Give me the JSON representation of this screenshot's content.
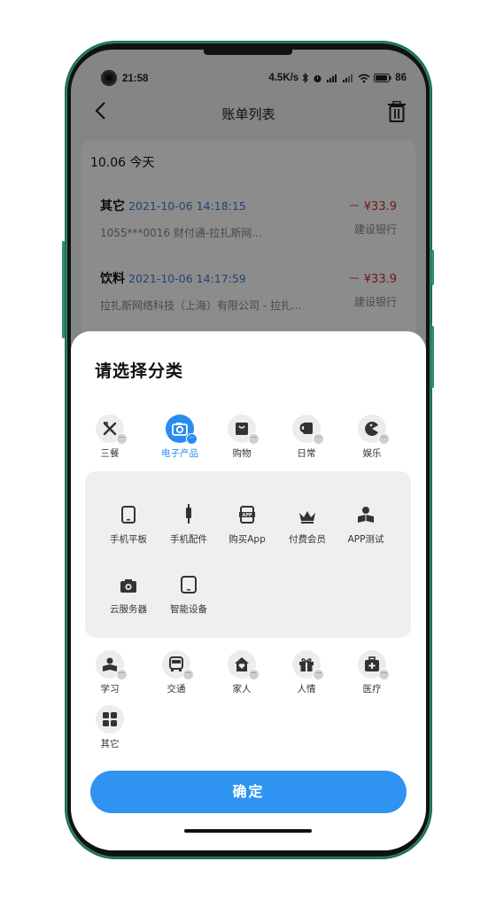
{
  "status": {
    "time": "21:58",
    "speed": "4.5K/s",
    "battery": "86"
  },
  "nav": {
    "title": "账单列表",
    "back_icon": "chevron-left-icon",
    "trash_icon": "trash-icon"
  },
  "list": {
    "date_header": "10.06 今天",
    "bills": [
      {
        "category": "其它",
        "timestamp": "2021-10-06 14:18:15",
        "amount": "－ ¥33.9",
        "description": "1055***0016 财付通-拉扎斯网...",
        "bank": "建设银行"
      },
      {
        "category": "饮料",
        "timestamp": "2021-10-06 14:17:59",
        "amount": "－ ¥33.9",
        "description": "拉扎斯网络科技（上海）有限公司 - 拉扎...",
        "bank": "建设银行"
      }
    ]
  },
  "sheet": {
    "title": "请选择分类",
    "categories_row1": [
      {
        "label": "三餐",
        "icon": "fork-knife-icon",
        "active": false
      },
      {
        "label": "电子产品",
        "icon": "camera-icon",
        "active": true
      },
      {
        "label": "购物",
        "icon": "shopping-bag-icon",
        "active": false
      },
      {
        "label": "日常",
        "icon": "toilet-paper-icon",
        "active": false
      },
      {
        "label": "娱乐",
        "icon": "pacman-icon",
        "active": false
      }
    ],
    "subcategories": [
      {
        "label": "手机平板",
        "icon": "tablet-icon"
      },
      {
        "label": "手机配件",
        "icon": "usb-cable-icon"
      },
      {
        "label": "购买App",
        "icon": "app-badge-icon"
      },
      {
        "label": "付费会员",
        "icon": "crown-icon"
      },
      {
        "label": "APP测试",
        "icon": "reader-icon"
      },
      {
        "label": "云服务器",
        "icon": "camera-small-icon"
      },
      {
        "label": "智能设备",
        "icon": "smart-device-icon"
      }
    ],
    "categories_row2": [
      {
        "label": "学习",
        "icon": "study-icon"
      },
      {
        "label": "交通",
        "icon": "bus-icon"
      },
      {
        "label": "家人",
        "icon": "home-heart-icon"
      },
      {
        "label": "人情",
        "icon": "gift-icon"
      },
      {
        "label": "医疗",
        "icon": "medical-kit-icon"
      }
    ],
    "categories_row3": [
      {
        "label": "其它",
        "icon": "grid-icon"
      }
    ],
    "more_glyph": "···",
    "confirm_label": "确定"
  },
  "colors": {
    "accent": "#2a8cf0",
    "button": "#2f93f1",
    "amount": "#d12b2b",
    "timestamp": "#3a7fd0",
    "frame": "#2f8f77"
  }
}
